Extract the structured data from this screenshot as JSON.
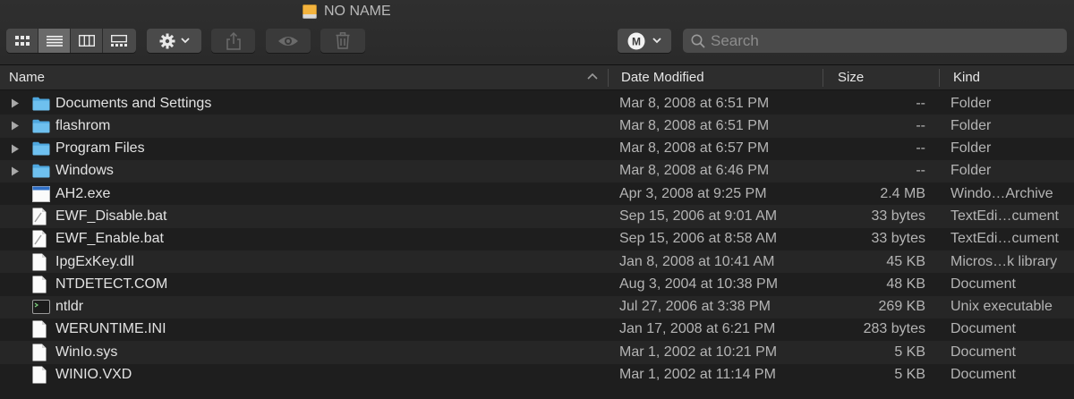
{
  "window": {
    "title": "NO NAME"
  },
  "toolbar": {
    "views": [
      "icon-view",
      "list-view",
      "column-view",
      "gallery-view"
    ],
    "active_view": "list-view",
    "group_icon": "M"
  },
  "search": {
    "placeholder": "Search",
    "value": ""
  },
  "columns": {
    "name": "Name",
    "date": "Date Modified",
    "size": "Size",
    "kind": "Kind"
  },
  "files": [
    {
      "name": "Documents and Settings",
      "date": "Mar 8, 2008 at 6:51 PM",
      "size": "--",
      "kind": "Folder",
      "icon": "folder-icon",
      "expandable": true
    },
    {
      "name": "flashrom",
      "date": "Mar 8, 2008 at 6:51 PM",
      "size": "--",
      "kind": "Folder",
      "icon": "folder-icon",
      "expandable": true
    },
    {
      "name": "Program Files",
      "date": "Mar 8, 2008 at 6:57 PM",
      "size": "--",
      "kind": "Folder",
      "icon": "folder-icon",
      "expandable": true
    },
    {
      "name": "Windows",
      "date": "Mar 8, 2008 at 6:46 PM",
      "size": "--",
      "kind": "Folder",
      "icon": "folder-icon",
      "expandable": true
    },
    {
      "name": "AH2.exe",
      "date": "Apr 3, 2008 at 9:25 PM",
      "size": "2.4 MB",
      "kind": "Windo…Archive",
      "icon": "exe-file-icon",
      "expandable": false
    },
    {
      "name": "EWF_Disable.bat",
      "date": "Sep 15, 2006 at 9:01 AM",
      "size": "33 bytes",
      "kind": "TextEdi…cument",
      "icon": "text-file-icon",
      "expandable": false
    },
    {
      "name": "EWF_Enable.bat",
      "date": "Sep 15, 2006 at 8:58 AM",
      "size": "33 bytes",
      "kind": "TextEdi…cument",
      "icon": "text-file-icon",
      "expandable": false
    },
    {
      "name": "IpgExKey.dll",
      "date": "Jan 8, 2008 at 10:41 AM",
      "size": "45 KB",
      "kind": "Micros…k library",
      "icon": "document-icon",
      "expandable": false
    },
    {
      "name": "NTDETECT.COM",
      "date": "Aug 3, 2004 at 10:38 PM",
      "size": "48 KB",
      "kind": "Document",
      "icon": "document-icon",
      "expandable": false
    },
    {
      "name": "ntldr",
      "date": "Jul 27, 2006 at 3:38 PM",
      "size": "269 KB",
      "kind": "Unix executable",
      "icon": "terminal-icon",
      "expandable": false
    },
    {
      "name": "WERUNTIME.INI",
      "date": "Jan 17, 2008 at 6:21 PM",
      "size": "283 bytes",
      "kind": "Document",
      "icon": "document-icon",
      "expandable": false
    },
    {
      "name": "WinIo.sys",
      "date": "Mar 1, 2002 at 10:21 PM",
      "size": "5 KB",
      "kind": "Document",
      "icon": "document-icon",
      "expandable": false
    },
    {
      "name": "WINIO.VXD",
      "date": "Mar 1, 2002 at 11:14 PM",
      "size": "5 KB",
      "kind": "Document",
      "icon": "document-icon",
      "expandable": false
    }
  ],
  "colors": {
    "background": "#1e1e1e",
    "folder": "#5fb3e6",
    "drive": "#f3b33d",
    "text": "#e2e2e2",
    "secondary_text": "#b4b4b4"
  }
}
